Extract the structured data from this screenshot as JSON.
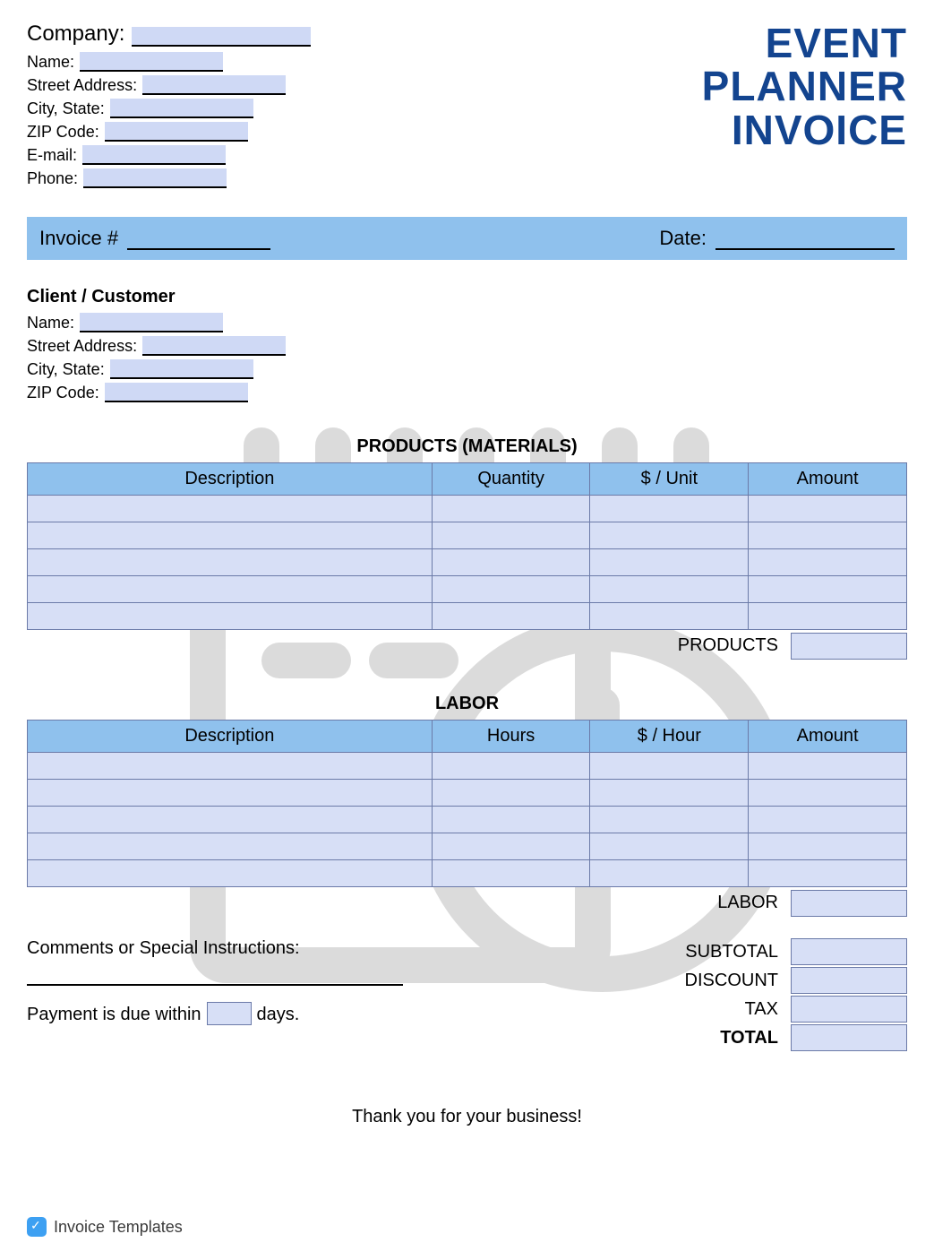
{
  "title": {
    "line1": "EVENT",
    "line2": "PLANNER",
    "line3": "INVOICE"
  },
  "company": {
    "label": "Company:",
    "name_label": "Name:",
    "street_label": "Street Address:",
    "city_state_label": "City, State:",
    "zip_label": "ZIP Code:",
    "email_label": "E-mail:",
    "phone_label": "Phone:"
  },
  "invoice_bar": {
    "invoice_label": "Invoice #",
    "date_label": "Date:"
  },
  "client": {
    "header": "Client / Customer",
    "name_label": "Name:",
    "street_label": "Street Address:",
    "city_state_label": "City, State:",
    "zip_label": "ZIP Code:"
  },
  "products": {
    "title": "PRODUCTS (MATERIALS)",
    "cols": {
      "desc": "Description",
      "qty": "Quantity",
      "unit": "$ / Unit",
      "amount": "Amount"
    },
    "subtotal_label": "PRODUCTS",
    "rows": 5
  },
  "labor": {
    "title": "LABOR",
    "cols": {
      "desc": "Description",
      "hours": "Hours",
      "rate": "$ / Hour",
      "amount": "Amount"
    },
    "subtotal_label": "LABOR",
    "rows": 5
  },
  "comments": {
    "label": "Comments or Special Instructions:"
  },
  "totals": {
    "subtotal": "SUBTOTAL",
    "discount": "DISCOUNT",
    "tax": "TAX",
    "total": "TOTAL"
  },
  "payment": {
    "prefix": "Payment is due within",
    "suffix": "days."
  },
  "thanks": "Thank you for your business!",
  "footer_brand": "Invoice Templates"
}
